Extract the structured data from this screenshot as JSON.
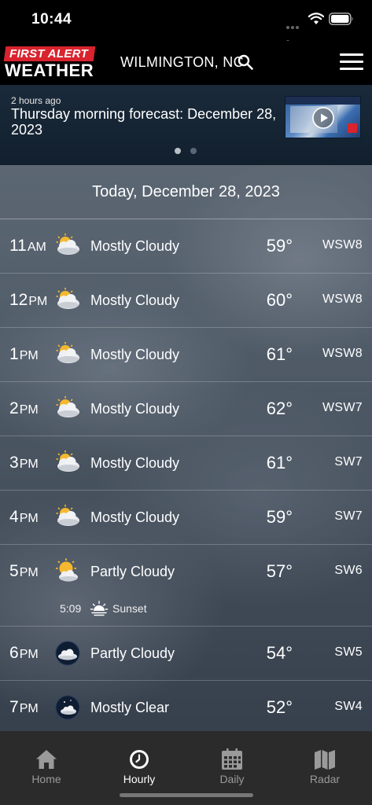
{
  "status_bar": {
    "time": "10:44",
    "icons": [
      "wifi-icon",
      "battery-icon"
    ]
  },
  "header": {
    "logo_top": "FIRST ALERT",
    "logo_bottom": "WEATHER",
    "location": "WILMINGTON, NC",
    "search_icon": "search-icon",
    "menu_icon": "menu-icon"
  },
  "news": {
    "age": "2 hours ago",
    "title": "Thursday morning forecast: December 28, 2023",
    "page_index": 1,
    "page_count": 2
  },
  "date_header": "Today, December 28, 2023",
  "hours": [
    {
      "hour": "11",
      "suffix": "AM",
      "icon": "mostly-cloudy-day-icon",
      "condition": "Mostly Cloudy",
      "temp": "59°",
      "wind": "WSW8"
    },
    {
      "hour": "12",
      "suffix": "PM",
      "icon": "mostly-cloudy-day-icon",
      "condition": "Mostly Cloudy",
      "temp": "60°",
      "wind": "WSW8"
    },
    {
      "hour": "1",
      "suffix": "PM",
      "icon": "mostly-cloudy-day-icon",
      "condition": "Mostly Cloudy",
      "temp": "61°",
      "wind": "WSW8"
    },
    {
      "hour": "2",
      "suffix": "PM",
      "icon": "mostly-cloudy-day-icon",
      "condition": "Mostly Cloudy",
      "temp": "62°",
      "wind": "WSW7"
    },
    {
      "hour": "3",
      "suffix": "PM",
      "icon": "mostly-cloudy-day-icon",
      "condition": "Mostly Cloudy",
      "temp": "61°",
      "wind": "SW7"
    },
    {
      "hour": "4",
      "suffix": "PM",
      "icon": "mostly-cloudy-day-icon",
      "condition": "Mostly Cloudy",
      "temp": "59°",
      "wind": "SW7"
    },
    {
      "hour": "5",
      "suffix": "PM",
      "icon": "partly-cloudy-day-icon",
      "condition": "Partly Cloudy",
      "temp": "57°",
      "wind": "SW6",
      "sunset_time": "5:09",
      "sunset_label": "Sunset"
    },
    {
      "hour": "6",
      "suffix": "PM",
      "icon": "partly-cloudy-night-icon",
      "condition": "Partly Cloudy",
      "temp": "54°",
      "wind": "SW5"
    },
    {
      "hour": "7",
      "suffix": "PM",
      "icon": "mostly-clear-night-icon",
      "condition": "Mostly Clear",
      "temp": "52°",
      "wind": "SW4"
    }
  ],
  "tabs": [
    {
      "label": "Home",
      "icon": "home-icon",
      "active": false
    },
    {
      "label": "Hourly",
      "icon": "clock-icon",
      "active": true
    },
    {
      "label": "Daily",
      "icon": "calendar-icon",
      "active": false
    },
    {
      "label": "Radar",
      "icon": "map-icon",
      "active": false
    }
  ],
  "colors": {
    "brand_red": "#d9232e",
    "header_bg": "#000000",
    "tab_bar_bg": "#2b2b2b",
    "tab_active": "#ffffff",
    "tab_inactive": "#9a9a9a"
  }
}
